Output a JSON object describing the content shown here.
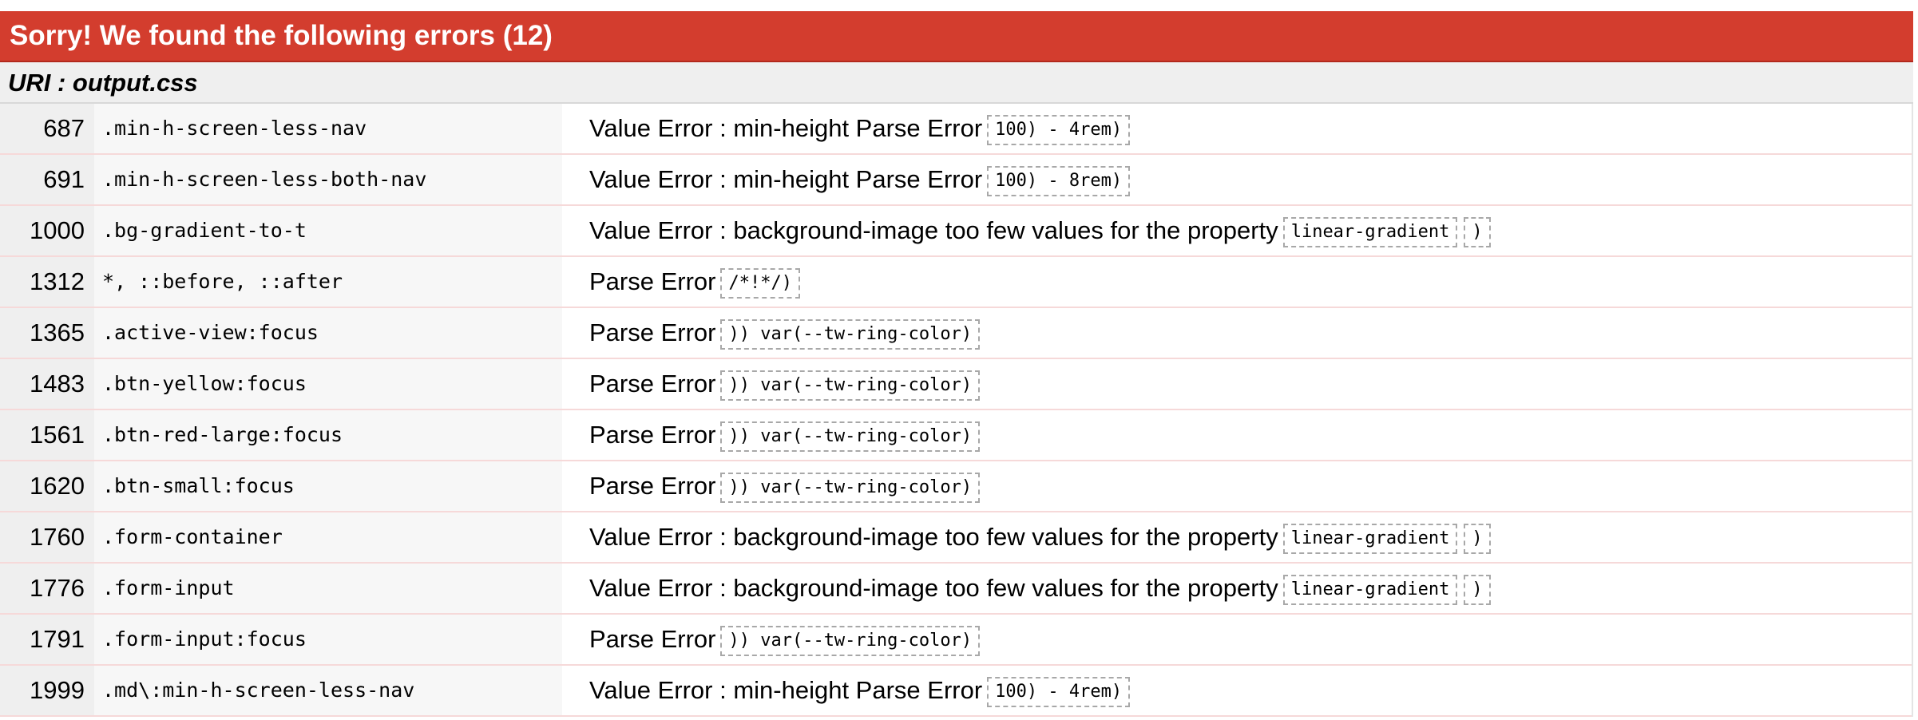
{
  "header": {
    "title": "Sorry! We found the following errors (12)"
  },
  "uri": {
    "label": "URI : output.css"
  },
  "errors": [
    {
      "line": "687",
      "context": ".min-h-screen-less-nav",
      "message": "Value Error : min-height Parse Error",
      "codes": [
        "100) - 4rem)"
      ]
    },
    {
      "line": "691",
      "context": ".min-h-screen-less-both-nav",
      "message": "Value Error : min-height Parse Error",
      "codes": [
        "100) - 8rem)"
      ]
    },
    {
      "line": "1000",
      "context": ".bg-gradient-to-t",
      "message": "Value Error : background-image too few values for the property",
      "codes": [
        "linear-gradient",
        ")"
      ]
    },
    {
      "line": "1312",
      "context": "*, ::before, ::after",
      "message": "Parse Error",
      "codes": [
        "/*!*/)"
      ]
    },
    {
      "line": "1365",
      "context": ".active-view:focus",
      "message": "Parse Error",
      "codes": [
        ")) var(--tw-ring-color)"
      ]
    },
    {
      "line": "1483",
      "context": ".btn-yellow:focus",
      "message": "Parse Error",
      "codes": [
        ")) var(--tw-ring-color)"
      ]
    },
    {
      "line": "1561",
      "context": ".btn-red-large:focus",
      "message": "Parse Error",
      "codes": [
        ")) var(--tw-ring-color)"
      ]
    },
    {
      "line": "1620",
      "context": ".btn-small:focus",
      "message": "Parse Error",
      "codes": [
        ")) var(--tw-ring-color)"
      ]
    },
    {
      "line": "1760",
      "context": ".form-container",
      "message": "Value Error : background-image too few values for the property",
      "codes": [
        "linear-gradient",
        ")"
      ]
    },
    {
      "line": "1776",
      "context": ".form-input",
      "message": "Value Error : background-image too few values for the property",
      "codes": [
        "linear-gradient",
        ")"
      ]
    },
    {
      "line": "1791",
      "context": ".form-input:focus",
      "message": "Parse Error",
      "codes": [
        ")) var(--tw-ring-color)"
      ]
    },
    {
      "line": "1999",
      "context": ".md\\:min-h-screen-less-nav",
      "message": "Value Error : min-height Parse Error",
      "codes": [
        "100) - 4rem)"
      ]
    }
  ]
}
